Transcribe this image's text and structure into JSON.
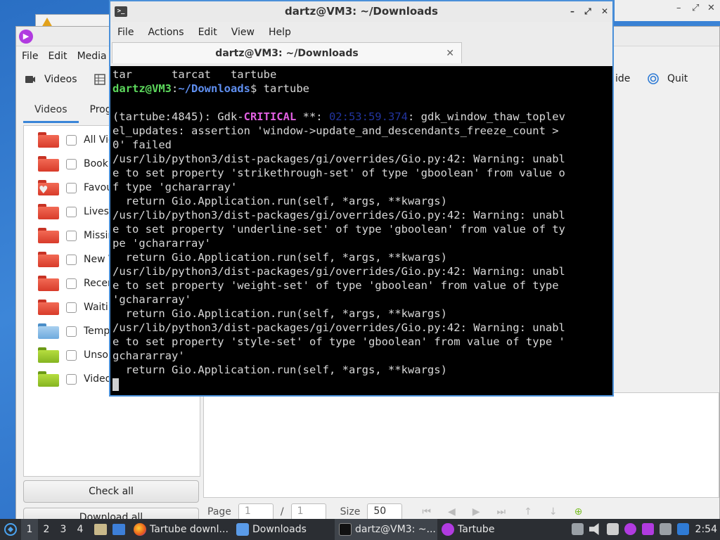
{
  "tartube": {
    "menu": [
      "File",
      "Edit",
      "Media"
    ],
    "toolbar": {
      "videos": "Videos",
      "hide": "ide",
      "quit": "Quit"
    },
    "tabs": [
      "Videos",
      "Prog"
    ],
    "folders": [
      {
        "label": "All Vid",
        "color": "red"
      },
      {
        "label": "Bookr",
        "color": "red"
      },
      {
        "label": "Favou",
        "color": "red"
      },
      {
        "label": "Livest",
        "color": "red"
      },
      {
        "label": "Missin",
        "color": "red"
      },
      {
        "label": "New V",
        "color": "red"
      },
      {
        "label": "Recen",
        "color": "red"
      },
      {
        "label": "Waitir",
        "color": "red"
      },
      {
        "label": "Tempo",
        "color": "blue"
      },
      {
        "label": "Unsor",
        "color": "green"
      },
      {
        "label": "Video",
        "color": "green"
      }
    ],
    "check_all": "Check all",
    "download_all": "Download all",
    "pager": {
      "page_label": "Page",
      "page_value": "1",
      "sep": "/",
      "total": "1",
      "size_label": "Size",
      "size_value": "50"
    }
  },
  "terminal": {
    "title": "dartz@VM3: ~/Downloads",
    "menu": [
      "File",
      "Actions",
      "Edit",
      "View",
      "Help"
    ],
    "tab_title": "dartz@VM3: ~/Downloads",
    "prompt_user": "dartz@VM3",
    "prompt_path": "~/Downloads",
    "lines": {
      "l0": "tar      tarcat   tartube",
      "cmd": "$ tartube",
      "crit_pre": "(tartube:4845): Gdk-",
      "crit_word": "CRITICAL",
      "crit_mid": " **: ",
      "crit_time": "02:53:59.374",
      "crit_post": ": gdk_window_thaw_toplev",
      "l4": "el_updates: assertion 'window->update_and_descendants_freeze_count >",
      "l5": "0' failed",
      "l6": "/usr/lib/python3/dist-packages/gi/overrides/Gio.py:42: Warning: unabl",
      "l7": "e to set property 'strikethrough-set' of type 'gboolean' from value o",
      "l8": "f type 'gchararray'",
      "l9": "  return Gio.Application.run(self, *args, **kwargs)",
      "l10": "/usr/lib/python3/dist-packages/gi/overrides/Gio.py:42: Warning: unabl",
      "l11": "e to set property 'underline-set' of type 'gboolean' from value of ty",
      "l12": "pe 'gchararray'",
      "l13": "  return Gio.Application.run(self, *args, **kwargs)",
      "l14": "/usr/lib/python3/dist-packages/gi/overrides/Gio.py:42: Warning: unabl",
      "l15": "e to set property 'weight-set' of type 'gboolean' from value of type",
      "l16": "'gchararray'",
      "l17": "  return Gio.Application.run(self, *args, **kwargs)",
      "l18": "/usr/lib/python3/dist-packages/gi/overrides/Gio.py:42: Warning: unabl",
      "l19": "e to set property 'style-set' of type 'gboolean' from value of type '",
      "l20": "gchararray'",
      "l21": "  return Gio.Application.run(self, *args, **kwargs)"
    }
  },
  "taskbar": {
    "workspaces": [
      "1",
      "2",
      "3",
      "4"
    ],
    "tasks": {
      "firefox": "Tartube downl...",
      "files": "Downloads",
      "terminal": "dartz@VM3: ~...",
      "tartube": "Tartube"
    },
    "clock": "2:54"
  }
}
